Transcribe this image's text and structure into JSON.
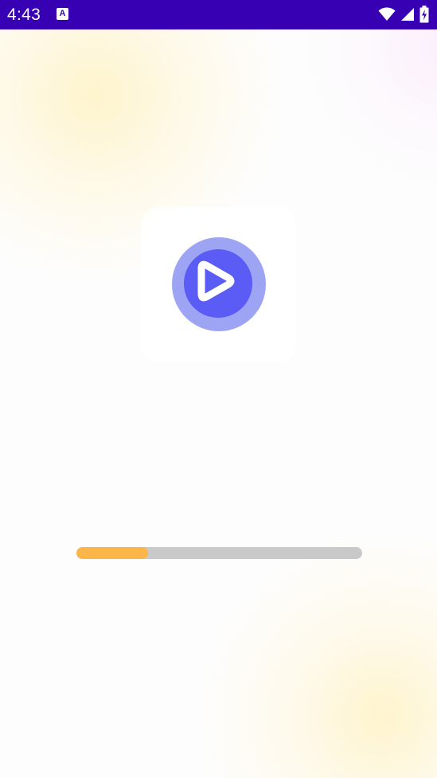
{
  "status_bar": {
    "time": "4:43",
    "app_icon": "text-a-icon",
    "app_icon_glyph": "A",
    "icons": [
      "wifi-icon",
      "cellular-signal-icon",
      "battery-charging-icon"
    ]
  },
  "splash": {
    "logo_icon": "play-circle-icon"
  },
  "progress": {
    "value_fraction": 0.25
  },
  "colors": {
    "status_bar": "#3700b3",
    "logo_primary": "#5b5bf5",
    "logo_secondary": "#9ea4f4",
    "progress_fill": "#fbb548",
    "progress_track": "#c9c9c9"
  }
}
